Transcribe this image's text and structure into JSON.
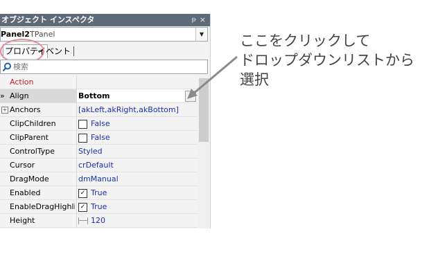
{
  "inspector": {
    "title": "オブジェクト インスペクタ",
    "pin": "ᵽ",
    "close": "×",
    "object_name": "Panel2",
    "object_type": "TPanel",
    "tabs": {
      "properties": "プロパティ",
      "events": "イベント"
    },
    "search_placeholder": "検索",
    "rows": [
      {
        "name": "Action",
        "value": ""
      },
      {
        "marker": "»",
        "name": "Align",
        "value": "Bottom"
      },
      {
        "expander": "+",
        "name": "Anchors",
        "value": "[akLeft,akRight,akBottom]"
      },
      {
        "name": "ClipChildren",
        "value": "False",
        "checked": false
      },
      {
        "name": "ClipParent",
        "value": "False",
        "checked": false
      },
      {
        "name": "ControlType",
        "value": "Styled"
      },
      {
        "name": "Cursor",
        "value": "crDefault"
      },
      {
        "name": "DragMode",
        "value": "dmManual"
      },
      {
        "name": "Enabled",
        "value": "True",
        "checked": true
      },
      {
        "name": "EnableDragHighlight",
        "value": "True",
        "checked": true
      },
      {
        "name": "Height",
        "value": "120"
      }
    ],
    "check_glyph": "✓",
    "dropdown_glyph": "▼"
  },
  "annotation": {
    "lines": [
      "ここをクリックして",
      "ドロップダウンリストから",
      "選択"
    ]
  },
  "colors": {
    "titlebar": "#5e6a78",
    "category_text": "#c02020",
    "value_text": "#1a2fb0",
    "highlight_circle": "#e88a94",
    "annotation_text": "#444444"
  }
}
